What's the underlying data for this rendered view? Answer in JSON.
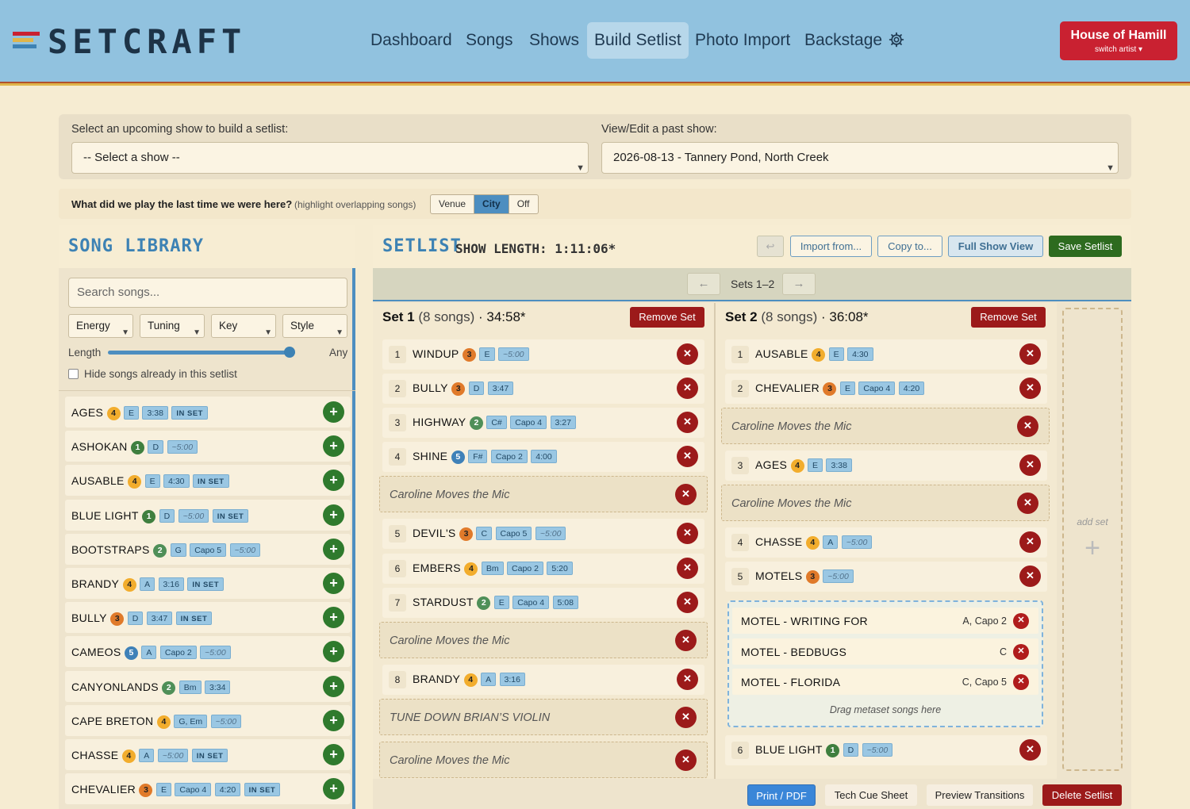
{
  "header": {
    "brand": "SETCRAFT",
    "nav": [
      "Dashboard",
      "Songs",
      "Shows",
      "Build Setlist",
      "Photo Import",
      "Backstage"
    ],
    "artist": {
      "name": "House of Hamill",
      "switch": "switch artist ▾"
    }
  },
  "shows": {
    "upcoming_label": "Select an upcoming show to build a setlist:",
    "upcoming_value": "-- Select a show --",
    "past_label": "View/Edit a past show:",
    "past_value": "2026-08-13 - Tannery Pond, North Creek"
  },
  "last_time": {
    "question": "What did we play the last time we were here?",
    "hint": "(highlight overlapping songs)",
    "options": [
      "Venue",
      "City",
      "Off"
    ],
    "selected": "City"
  },
  "library": {
    "title": "SONG LIBRARY",
    "search_placeholder": "Search songs...",
    "filters": [
      "Energy",
      "Tuning",
      "Key",
      "Style"
    ],
    "length_label": "Length",
    "length_value": "Any",
    "hide_label": "Hide songs already in this setlist",
    "songs": [
      {
        "name": "AGES",
        "energy": "4",
        "tags": [
          "E",
          "3:38"
        ],
        "in_set": "IN SET"
      },
      {
        "name": "ASHOKAN",
        "energy": "1",
        "tags": [
          "D",
          "~5:00"
        ],
        "in_set": ""
      },
      {
        "name": "AUSABLE",
        "energy": "4",
        "tags": [
          "E",
          "4:30"
        ],
        "in_set": "IN SET"
      },
      {
        "name": "BLUE LIGHT",
        "energy": "1",
        "tags": [
          "D",
          "~5:00"
        ],
        "in_set": "IN SET"
      },
      {
        "name": "BOOTSTRAPS",
        "energy": "2",
        "tags": [
          "G",
          "Capo 5",
          "~5:00"
        ],
        "in_set": ""
      },
      {
        "name": "BRANDY",
        "energy": "4",
        "tags": [
          "A",
          "3:16"
        ],
        "in_set": "IN SET"
      },
      {
        "name": "BULLY",
        "energy": "3",
        "tags": [
          "D",
          "3:47"
        ],
        "in_set": "IN SET"
      },
      {
        "name": "CAMEOS",
        "energy": "5",
        "tags": [
          "A",
          "Capo 2",
          "~5:00"
        ],
        "in_set": ""
      },
      {
        "name": "CANYONLANDS",
        "energy": "2",
        "tags": [
          "Bm",
          "3:34"
        ],
        "in_set": ""
      },
      {
        "name": "CAPE BRETON",
        "energy": "4",
        "tags": [
          "G, Em",
          "~5:00"
        ],
        "in_set": ""
      },
      {
        "name": "CHASSE",
        "energy": "4",
        "tags": [
          "A",
          "~5:00"
        ],
        "in_set": "IN SET"
      },
      {
        "name": "CHEVALIER",
        "energy": "3",
        "tags": [
          "E",
          "Capo 4",
          "4:20"
        ],
        "in_set": "IN SET"
      }
    ]
  },
  "setlist": {
    "title": "SETLIST",
    "length_label": "SHOW LENGTH: 1:11:06*",
    "undo": "↩",
    "buttons": [
      "Import from...",
      "Copy to...",
      "Full Show View",
      "Save Setlist"
    ],
    "pager": {
      "prev": "←",
      "label": "Sets 1–2",
      "next": "→"
    },
    "remove_set": "Remove Set",
    "add_set": "add set",
    "add_plus": "+",
    "set1": {
      "name": "Set 1",
      "count": "(8 songs)",
      "time": "· 34:58*"
    },
    "set2": {
      "name": "Set 2",
      "count": "(8 songs)",
      "time": "· 36:08*"
    },
    "note": "Caroline Moves the Mic",
    "note2": "TUNE DOWN BRIAN’S VIOLIN",
    "s1": [
      {
        "n": "1",
        "name": "WINDUP",
        "energy": "3",
        "tags": [
          "E",
          "~5:00"
        ]
      },
      {
        "n": "2",
        "name": "BULLY",
        "energy": "3",
        "tags": [
          "D",
          "3:47"
        ]
      },
      {
        "n": "3",
        "name": "HIGHWAY",
        "energy": "2",
        "tags": [
          "C#",
          "Capo 4",
          "3:27"
        ]
      },
      {
        "n": "4",
        "name": "SHINE",
        "energy": "5",
        "tags": [
          "F#",
          "Capo 2",
          "4:00"
        ]
      },
      {
        "n": "5",
        "name": "DEVIL'S",
        "energy": "3",
        "tags": [
          "C",
          "Capo 5",
          "~5:00"
        ]
      },
      {
        "n": "6",
        "name": "EMBERS",
        "energy": "4",
        "tags": [
          "Bm",
          "Capo 2",
          "5:20"
        ]
      },
      {
        "n": "7",
        "name": "STARDUST",
        "energy": "2",
        "tags": [
          "E",
          "Capo 4",
          "5:08"
        ]
      },
      {
        "n": "8",
        "name": "BRANDY",
        "energy": "4",
        "tags": [
          "A",
          "3:16"
        ]
      }
    ],
    "s2": [
      {
        "n": "1",
        "name": "AUSABLE",
        "energy": "4",
        "tags": [
          "E",
          "4:30"
        ]
      },
      {
        "n": "2",
        "name": "CHEVALIER",
        "energy": "3",
        "tags": [
          "E",
          "Capo 4",
          "4:20"
        ]
      },
      {
        "n": "3",
        "name": "AGES",
        "energy": "4",
        "tags": [
          "E",
          "3:38"
        ]
      },
      {
        "n": "4",
        "name": "CHASSE",
        "energy": "4",
        "tags": [
          "A",
          "~5:00"
        ]
      },
      {
        "n": "5",
        "name": "MOTELS",
        "energy": "3",
        "tags": [
          "~5:00"
        ]
      },
      {
        "n": "6",
        "name": "BLUE LIGHT",
        "energy": "1",
        "tags": [
          "D",
          "~5:00"
        ]
      }
    ],
    "metaset": [
      {
        "name": "MOTEL - WRITING FOR",
        "key": "A, Capo 2"
      },
      {
        "name": "MOTEL - BEDBUGS",
        "key": "C"
      },
      {
        "name": "MOTEL - FLORIDA",
        "key": "C, Capo 5"
      }
    ],
    "metaset_hint": "Drag metaset songs here",
    "footer": [
      "Print / PDF",
      "Tech Cue Sheet",
      "Preview Transitions",
      "Delete Setlist"
    ]
  },
  "colors": {
    "header": "#91c2df",
    "accent": "#4d8ec0",
    "danger": "#9c1a1a",
    "add": "#2f7a2d",
    "save": "#2d6b1f"
  }
}
